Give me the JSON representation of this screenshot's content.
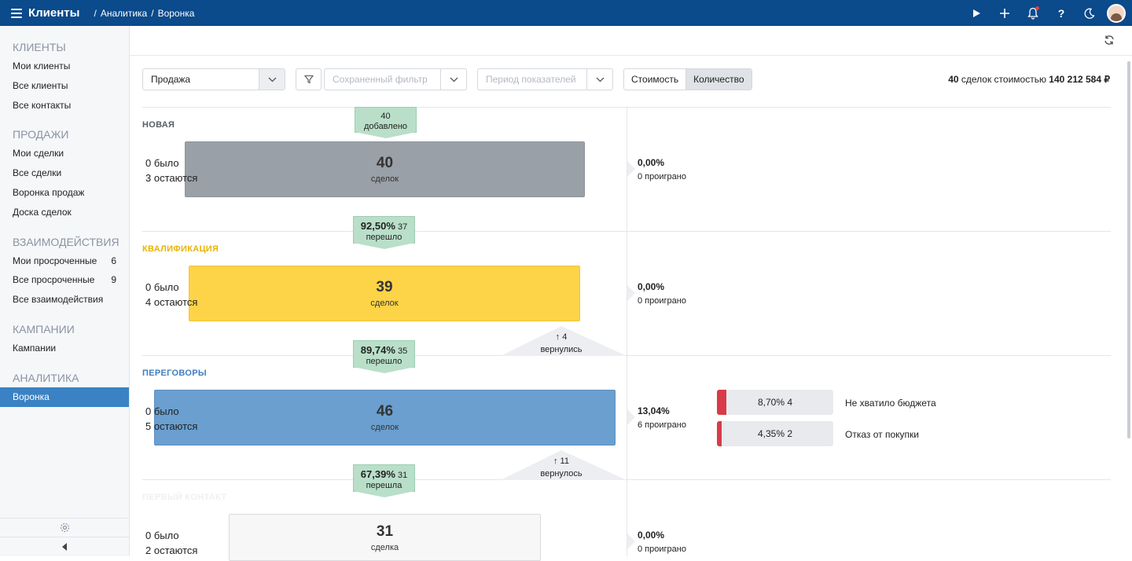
{
  "app": {
    "title": "Клиенты"
  },
  "breadcrumb": [
    "/",
    "Аналитика",
    "/",
    "Воронка"
  ],
  "sidebar": {
    "sections": [
      {
        "title": "КЛИЕНТЫ",
        "items": [
          {
            "label": "Мои клиенты",
            "count": ""
          },
          {
            "label": "Все клиенты",
            "count": ""
          },
          {
            "label": "Все контакты",
            "count": ""
          }
        ]
      },
      {
        "title": "ПРОДАЖИ",
        "items": [
          {
            "label": "Мои сделки",
            "count": ""
          },
          {
            "label": "Все сделки",
            "count": ""
          },
          {
            "label": "Воронка продаж",
            "count": ""
          },
          {
            "label": "Доска сделок",
            "count": ""
          }
        ]
      },
      {
        "title": "ВЗАИМОДЕЙСТВИЯ",
        "items": [
          {
            "label": "Мои просроченные",
            "count": "6"
          },
          {
            "label": "Все просроченные",
            "count": "9"
          },
          {
            "label": "Все взаимодействия",
            "count": ""
          }
        ]
      },
      {
        "title": "КАМПАНИИ",
        "items": [
          {
            "label": "Кампании",
            "count": ""
          }
        ]
      },
      {
        "title": "АНАЛИТИКА",
        "items": [
          {
            "label": "Воронка",
            "count": "",
            "active": true
          }
        ]
      }
    ]
  },
  "filters": {
    "funnel": "Продажа",
    "saved_filter_placeholder": "Сохраненный фильтр",
    "period_placeholder": "Период показателей",
    "toggle": [
      "Стоимость",
      "Количество"
    ],
    "toggle_selected": "Количество"
  },
  "summary": {
    "count": "40",
    "middle": " сделок стоимостью ",
    "amount": "140 212 584 ₽"
  },
  "stages": [
    {
      "name": "НОВАЯ",
      "color": "#555d66",
      "bar_color": "#9aa0a7",
      "count": "40",
      "unit": "сделок",
      "was": "0 было",
      "remain": "3 остаются",
      "lost_pct": "0,00%",
      "lost_txt": "0 проиграно",
      "badge": {
        "pct": "",
        "num": "40",
        "txt": "добавлено"
      }
    },
    {
      "name": "КВАЛИФИКАЦИЯ",
      "color": "#e8b400",
      "bar_color": "#fdd347",
      "count": "39",
      "unit": "сделок",
      "was": "0 было",
      "remain": "4 остаются",
      "lost_pct": "0,00%",
      "lost_txt": "0 проиграно",
      "badge": {
        "pct": "92,50%",
        "num": "37",
        "txt": "перешло"
      }
    },
    {
      "name": "ПЕРЕГОВОРЫ",
      "color": "#3f7fbf",
      "bar_color": "#6a9fd0",
      "count": "46",
      "unit": "сделок",
      "was": "0 было",
      "remain": "5 остаются",
      "lost_pct": "13,04%",
      "lost_txt": "6 проиграно",
      "badge": {
        "pct": "89,74%",
        "num": "35",
        "txt": "перешло"
      },
      "returned": {
        "num": "↑ 4",
        "txt": "вернулись"
      },
      "reasons": [
        {
          "value": "8,70% 4",
          "label": "Не хватило бюджета"
        },
        {
          "value": "4,35% 2",
          "label": "Отказ от покупки"
        }
      ]
    },
    {
      "name": "ПЕРВЫЙ КОНТАКТ",
      "color": "#eef0f2",
      "bar_color": "#f7f7f7",
      "count": "31",
      "unit": "сделка",
      "was": "0 было",
      "remain": "2 остаются",
      "lost_pct": "0,00%",
      "lost_txt": "0 проиграно",
      "badge": {
        "pct": "67,39%",
        "num": "31",
        "txt": "перешла"
      },
      "returned": {
        "num": "↑ 11",
        "txt": "вернулось"
      }
    }
  ],
  "colors": {
    "topbar": "#0b4a8b",
    "accent": "#3b82c4",
    "badge": "#b9dfc9",
    "lost_reason": "#d93a4a"
  },
  "icons": [
    "menu-icon",
    "play-icon",
    "plus-icon",
    "bell-icon",
    "help-icon",
    "moon-icon",
    "refresh-icon",
    "filter-icon",
    "chevron-down-icon",
    "gear-icon",
    "collapse-icon"
  ]
}
